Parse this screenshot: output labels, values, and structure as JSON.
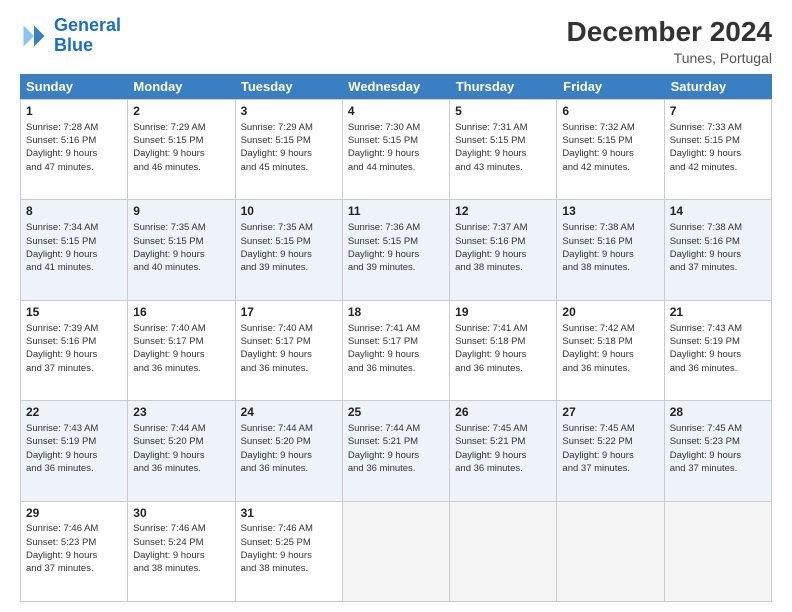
{
  "logo": {
    "text_general": "General",
    "text_blue": "Blue"
  },
  "header": {
    "month_year": "December 2024",
    "location": "Tunes, Portugal"
  },
  "weekdays": [
    "Sunday",
    "Monday",
    "Tuesday",
    "Wednesday",
    "Thursday",
    "Friday",
    "Saturday"
  ],
  "weeks": [
    [
      {
        "day": "1",
        "lines": [
          "Sunrise: 7:28 AM",
          "Sunset: 5:16 PM",
          "Daylight: 9 hours",
          "and 47 minutes."
        ],
        "empty": false,
        "alt": false
      },
      {
        "day": "2",
        "lines": [
          "Sunrise: 7:29 AM",
          "Sunset: 5:15 PM",
          "Daylight: 9 hours",
          "and 46 minutes."
        ],
        "empty": false,
        "alt": false
      },
      {
        "day": "3",
        "lines": [
          "Sunrise: 7:29 AM",
          "Sunset: 5:15 PM",
          "Daylight: 9 hours",
          "and 45 minutes."
        ],
        "empty": false,
        "alt": false
      },
      {
        "day": "4",
        "lines": [
          "Sunrise: 7:30 AM",
          "Sunset: 5:15 PM",
          "Daylight: 9 hours",
          "and 44 minutes."
        ],
        "empty": false,
        "alt": false
      },
      {
        "day": "5",
        "lines": [
          "Sunrise: 7:31 AM",
          "Sunset: 5:15 PM",
          "Daylight: 9 hours",
          "and 43 minutes."
        ],
        "empty": false,
        "alt": false
      },
      {
        "day": "6",
        "lines": [
          "Sunrise: 7:32 AM",
          "Sunset: 5:15 PM",
          "Daylight: 9 hours",
          "and 42 minutes."
        ],
        "empty": false,
        "alt": false
      },
      {
        "day": "7",
        "lines": [
          "Sunrise: 7:33 AM",
          "Sunset: 5:15 PM",
          "Daylight: 9 hours",
          "and 42 minutes."
        ],
        "empty": false,
        "alt": false
      }
    ],
    [
      {
        "day": "8",
        "lines": [
          "Sunrise: 7:34 AM",
          "Sunset: 5:15 PM",
          "Daylight: 9 hours",
          "and 41 minutes."
        ],
        "empty": false,
        "alt": true
      },
      {
        "day": "9",
        "lines": [
          "Sunrise: 7:35 AM",
          "Sunset: 5:15 PM",
          "Daylight: 9 hours",
          "and 40 minutes."
        ],
        "empty": false,
        "alt": true
      },
      {
        "day": "10",
        "lines": [
          "Sunrise: 7:35 AM",
          "Sunset: 5:15 PM",
          "Daylight: 9 hours",
          "and 39 minutes."
        ],
        "empty": false,
        "alt": true
      },
      {
        "day": "11",
        "lines": [
          "Sunrise: 7:36 AM",
          "Sunset: 5:15 PM",
          "Daylight: 9 hours",
          "and 39 minutes."
        ],
        "empty": false,
        "alt": true
      },
      {
        "day": "12",
        "lines": [
          "Sunrise: 7:37 AM",
          "Sunset: 5:16 PM",
          "Daylight: 9 hours",
          "and 38 minutes."
        ],
        "empty": false,
        "alt": true
      },
      {
        "day": "13",
        "lines": [
          "Sunrise: 7:38 AM",
          "Sunset: 5:16 PM",
          "Daylight: 9 hours",
          "and 38 minutes."
        ],
        "empty": false,
        "alt": true
      },
      {
        "day": "14",
        "lines": [
          "Sunrise: 7:38 AM",
          "Sunset: 5:16 PM",
          "Daylight: 9 hours",
          "and 37 minutes."
        ],
        "empty": false,
        "alt": true
      }
    ],
    [
      {
        "day": "15",
        "lines": [
          "Sunrise: 7:39 AM",
          "Sunset: 5:16 PM",
          "Daylight: 9 hours",
          "and 37 minutes."
        ],
        "empty": false,
        "alt": false
      },
      {
        "day": "16",
        "lines": [
          "Sunrise: 7:40 AM",
          "Sunset: 5:17 PM",
          "Daylight: 9 hours",
          "and 36 minutes."
        ],
        "empty": false,
        "alt": false
      },
      {
        "day": "17",
        "lines": [
          "Sunrise: 7:40 AM",
          "Sunset: 5:17 PM",
          "Daylight: 9 hours",
          "and 36 minutes."
        ],
        "empty": false,
        "alt": false
      },
      {
        "day": "18",
        "lines": [
          "Sunrise: 7:41 AM",
          "Sunset: 5:17 PM",
          "Daylight: 9 hours",
          "and 36 minutes."
        ],
        "empty": false,
        "alt": false
      },
      {
        "day": "19",
        "lines": [
          "Sunrise: 7:41 AM",
          "Sunset: 5:18 PM",
          "Daylight: 9 hours",
          "and 36 minutes."
        ],
        "empty": false,
        "alt": false
      },
      {
        "day": "20",
        "lines": [
          "Sunrise: 7:42 AM",
          "Sunset: 5:18 PM",
          "Daylight: 9 hours",
          "and 36 minutes."
        ],
        "empty": false,
        "alt": false
      },
      {
        "day": "21",
        "lines": [
          "Sunrise: 7:43 AM",
          "Sunset: 5:19 PM",
          "Daylight: 9 hours",
          "and 36 minutes."
        ],
        "empty": false,
        "alt": false
      }
    ],
    [
      {
        "day": "22",
        "lines": [
          "Sunrise: 7:43 AM",
          "Sunset: 5:19 PM",
          "Daylight: 9 hours",
          "and 36 minutes."
        ],
        "empty": false,
        "alt": true
      },
      {
        "day": "23",
        "lines": [
          "Sunrise: 7:44 AM",
          "Sunset: 5:20 PM",
          "Daylight: 9 hours",
          "and 36 minutes."
        ],
        "empty": false,
        "alt": true
      },
      {
        "day": "24",
        "lines": [
          "Sunrise: 7:44 AM",
          "Sunset: 5:20 PM",
          "Daylight: 9 hours",
          "and 36 minutes."
        ],
        "empty": false,
        "alt": true
      },
      {
        "day": "25",
        "lines": [
          "Sunrise: 7:44 AM",
          "Sunset: 5:21 PM",
          "Daylight: 9 hours",
          "and 36 minutes."
        ],
        "empty": false,
        "alt": true
      },
      {
        "day": "26",
        "lines": [
          "Sunrise: 7:45 AM",
          "Sunset: 5:21 PM",
          "Daylight: 9 hours",
          "and 36 minutes."
        ],
        "empty": false,
        "alt": true
      },
      {
        "day": "27",
        "lines": [
          "Sunrise: 7:45 AM",
          "Sunset: 5:22 PM",
          "Daylight: 9 hours",
          "and 37 minutes."
        ],
        "empty": false,
        "alt": true
      },
      {
        "day": "28",
        "lines": [
          "Sunrise: 7:45 AM",
          "Sunset: 5:23 PM",
          "Daylight: 9 hours",
          "and 37 minutes."
        ],
        "empty": false,
        "alt": true
      }
    ],
    [
      {
        "day": "29",
        "lines": [
          "Sunrise: 7:46 AM",
          "Sunset: 5:23 PM",
          "Daylight: 9 hours",
          "and 37 minutes."
        ],
        "empty": false,
        "alt": false
      },
      {
        "day": "30",
        "lines": [
          "Sunrise: 7:46 AM",
          "Sunset: 5:24 PM",
          "Daylight: 9 hours",
          "and 38 minutes."
        ],
        "empty": false,
        "alt": false
      },
      {
        "day": "31",
        "lines": [
          "Sunrise: 7:46 AM",
          "Sunset: 5:25 PM",
          "Daylight: 9 hours",
          "and 38 minutes."
        ],
        "empty": false,
        "alt": false
      },
      {
        "day": "",
        "lines": [],
        "empty": true,
        "alt": false
      },
      {
        "day": "",
        "lines": [],
        "empty": true,
        "alt": false
      },
      {
        "day": "",
        "lines": [],
        "empty": true,
        "alt": false
      },
      {
        "day": "",
        "lines": [],
        "empty": true,
        "alt": false
      }
    ]
  ]
}
